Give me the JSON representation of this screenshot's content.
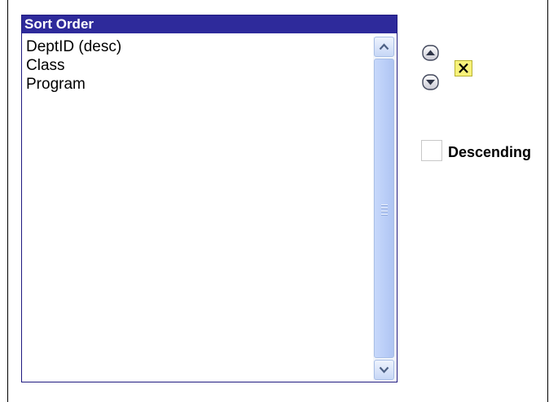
{
  "listbox": {
    "title": "Sort Order",
    "items": [
      {
        "label": "DeptID (desc)"
      },
      {
        "label": "Class"
      },
      {
        "label": "Program"
      }
    ]
  },
  "controls": {
    "move_up_icon": "circle-up-arrow",
    "move_down_icon": "circle-down-arrow",
    "delete_icon": "x-mark",
    "descending_label": "Descending",
    "descending_checked": false
  },
  "colors": {
    "header_bg": "#2e2a9b",
    "delete_bg": "#f7f27a"
  }
}
